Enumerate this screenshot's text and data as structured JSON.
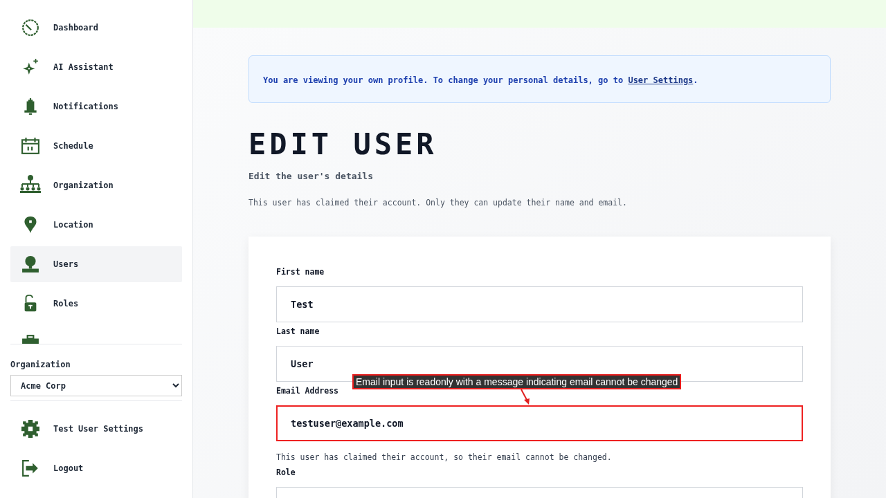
{
  "sidebar": {
    "items": [
      {
        "label": "Dashboard",
        "selected": false
      },
      {
        "label": "AI Assistant",
        "selected": false
      },
      {
        "label": "Notifications",
        "selected": false
      },
      {
        "label": "Schedule",
        "selected": false
      },
      {
        "label": "Organization",
        "selected": false
      },
      {
        "label": "Location",
        "selected": false
      },
      {
        "label": "Users",
        "selected": true
      },
      {
        "label": "Roles",
        "selected": false
      },
      {
        "selected": false
      }
    ],
    "organization": {
      "label": "Organization",
      "value": "Acme Corp"
    },
    "footer_items": [
      {
        "label": "Test User Settings"
      },
      {
        "label": "Logout"
      }
    ]
  },
  "alert": {
    "text": "You are viewing your own profile. To change your personal details, go to",
    "link": "User Settings",
    "end": "."
  },
  "title": "EDIT USER",
  "subtitle": "Edit the user's details",
  "note": "This user has claimed their account. Only they can update their name and email.",
  "form": {
    "fields": [
      {
        "label": "First name",
        "value": "Test",
        "highlighted": false
      },
      {
        "label": "Last name",
        "value": "User",
        "highlighted": false
      },
      {
        "label": "Email Address",
        "value": "testuser@example.com",
        "highlighted": true,
        "hint": "This user has claimed their account, so their email cannot be changed."
      },
      {
        "label": "Role",
        "highlighted": false
      }
    ]
  },
  "annotation": {
    "text": "Email input is readonly with a message indicating email cannot be changed"
  }
}
